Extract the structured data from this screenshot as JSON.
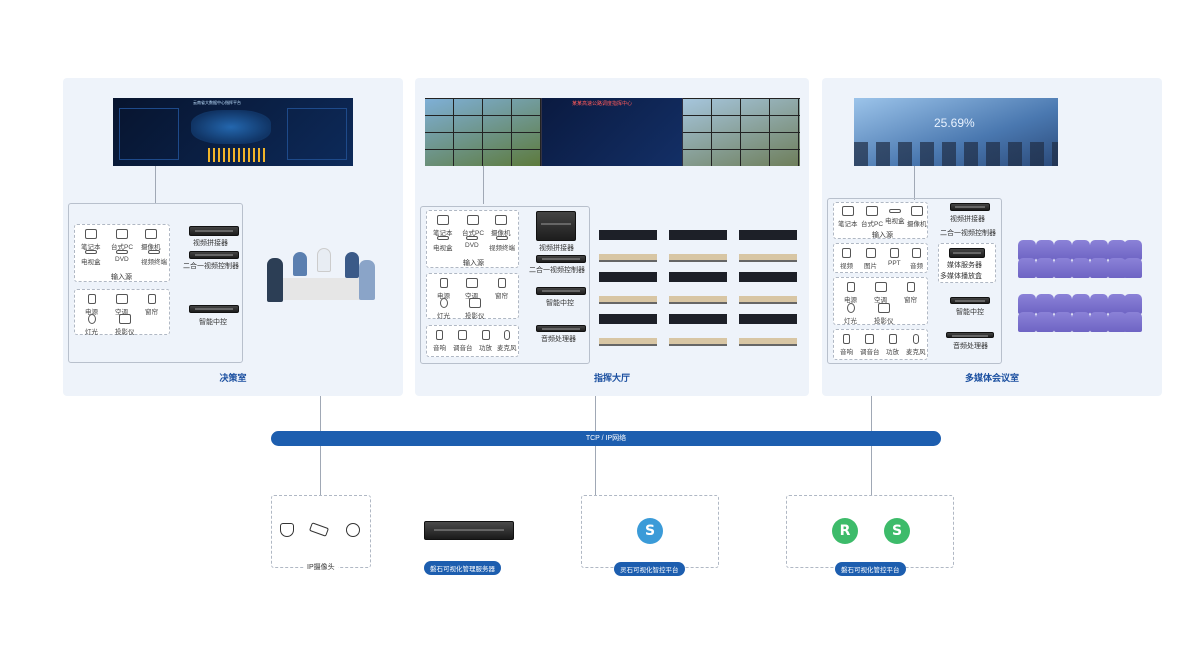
{
  "panels": {
    "decision": {
      "title": "决策室",
      "inputs": [
        "笔记本",
        "台式PC",
        "摄像机",
        "电视盒",
        "DVD",
        "视频终端"
      ],
      "input_source": "输入源",
      "env": [
        "电源",
        "空调",
        "窗帘",
        "灯光",
        "投影仪"
      ],
      "devices": [
        "视频拼接器",
        "二合一视频控制器",
        "智能中控"
      ],
      "screen_title": "云南省大数据中心指挥平台"
    },
    "command": {
      "title": "指挥大厅",
      "inputs": [
        "笔记本",
        "台式PC",
        "摄像机",
        "电视盒",
        "DVD",
        "视频终端"
      ],
      "input_source": "输入源",
      "env": [
        "电源",
        "空调",
        "窗帘",
        "灯光",
        "投影仪"
      ],
      "audio": [
        "音响",
        "调音台",
        "功放",
        "麦克风"
      ],
      "devices": [
        "视频拼接器",
        "二合一视频控制器",
        "智能中控",
        "音频处理器"
      ],
      "screen_title": "某某高速公路调度指挥中心"
    },
    "multimedia": {
      "title": "多媒体会议室",
      "inputs": [
        "笔记本",
        "台式PC",
        "电视盒",
        "摄像机"
      ],
      "input_source": "输入源",
      "media": [
        "视频",
        "图片",
        "PPT",
        "音频"
      ],
      "env": [
        "电源",
        "空调",
        "窗帘",
        "灯光",
        "投影仪"
      ],
      "audio": [
        "音响",
        "调音台",
        "功放",
        "麦克风"
      ],
      "devices": [
        "视频拼接器",
        "二合一视频控制器",
        "媒体服务器",
        "多媒体播放盒",
        "智能中控",
        "音频处理器"
      ],
      "screen_text": "25.69%"
    }
  },
  "network": {
    "label": "TCP / IP网络"
  },
  "bottom": {
    "ip_camera": "IP摄像头",
    "server": "磐石可视化管理服务器",
    "lingshi": "灵石可视化智控平台",
    "panshi": "磐石可视化管控平台",
    "logo_s": "S",
    "logo_r": "R"
  },
  "colors": {
    "accent": "#1d5eaf",
    "panel_bg": "#eef3fa",
    "logo_blue": "#3b9bd8",
    "logo_green": "#3dbb6a"
  }
}
